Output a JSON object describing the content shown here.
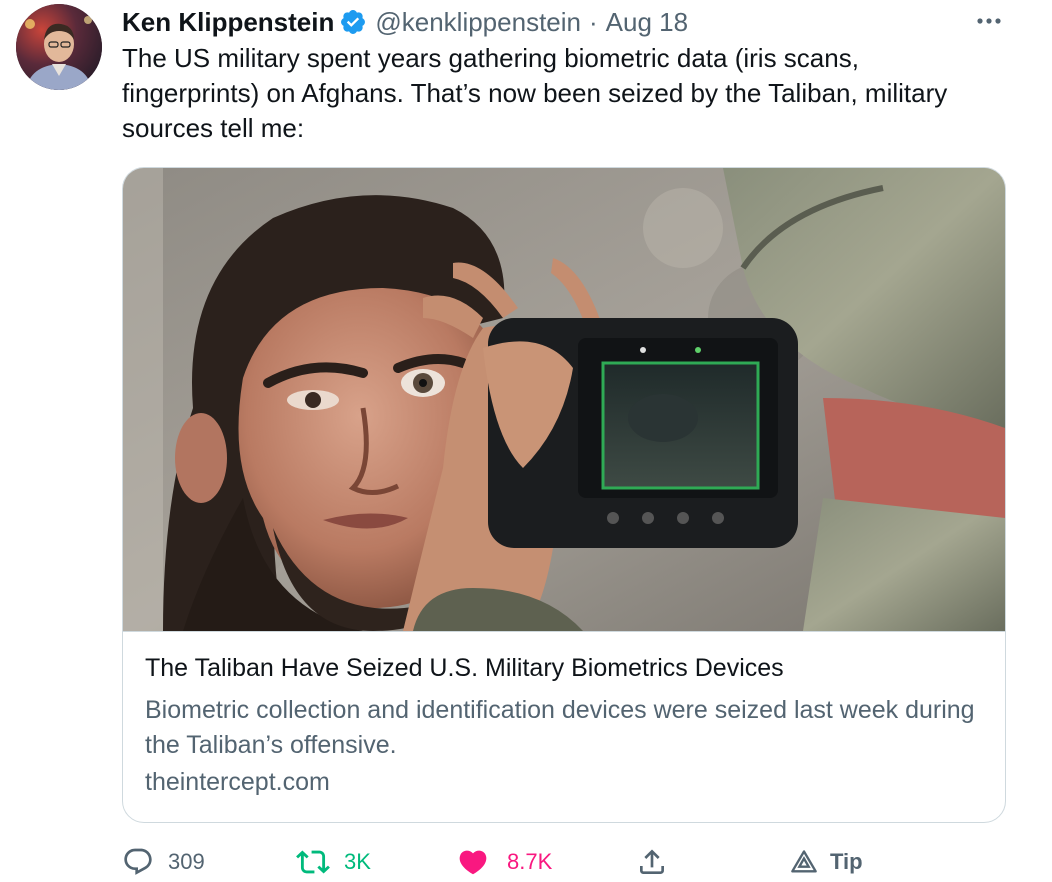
{
  "tweet": {
    "author": {
      "display_name": "Ken Klippenstein",
      "handle": "@kenklippenstein",
      "verified": true,
      "avatar_icon": "user-avatar-photo"
    },
    "separator": "·",
    "date": "Aug 18",
    "more_icon": "more-horizontal-icon",
    "text": "The US military spent years gathering biometric data (iris scans, fingerprints) on Afghans. That’s now been seized by the Taliban, military sources tell me:"
  },
  "card": {
    "image_icon": "article-photo-iris-scan",
    "title": "The Taliban Have Seized U.S. Military Biometrics Devices",
    "description": "Biometric collection and identification devices were seized last week during the Taliban’s offensive.",
    "domain": "theintercept.com"
  },
  "actions": {
    "reply": {
      "icon": "reply-icon",
      "count": "309"
    },
    "retweet": {
      "icon": "retweet-icon",
      "count": "3K",
      "active": true
    },
    "like": {
      "icon": "heart-icon",
      "count": "8.7K",
      "active": true
    },
    "share": {
      "icon": "share-icon"
    },
    "tip": {
      "icon": "tip-icon",
      "label": "Tip"
    }
  },
  "colors": {
    "text_primary": "#0f1419",
    "text_secondary": "#536471",
    "verified_blue": "#1d9bf0",
    "retweet_green": "#00ba7c",
    "like_pink": "#f91880",
    "border": "#cfd9de"
  }
}
